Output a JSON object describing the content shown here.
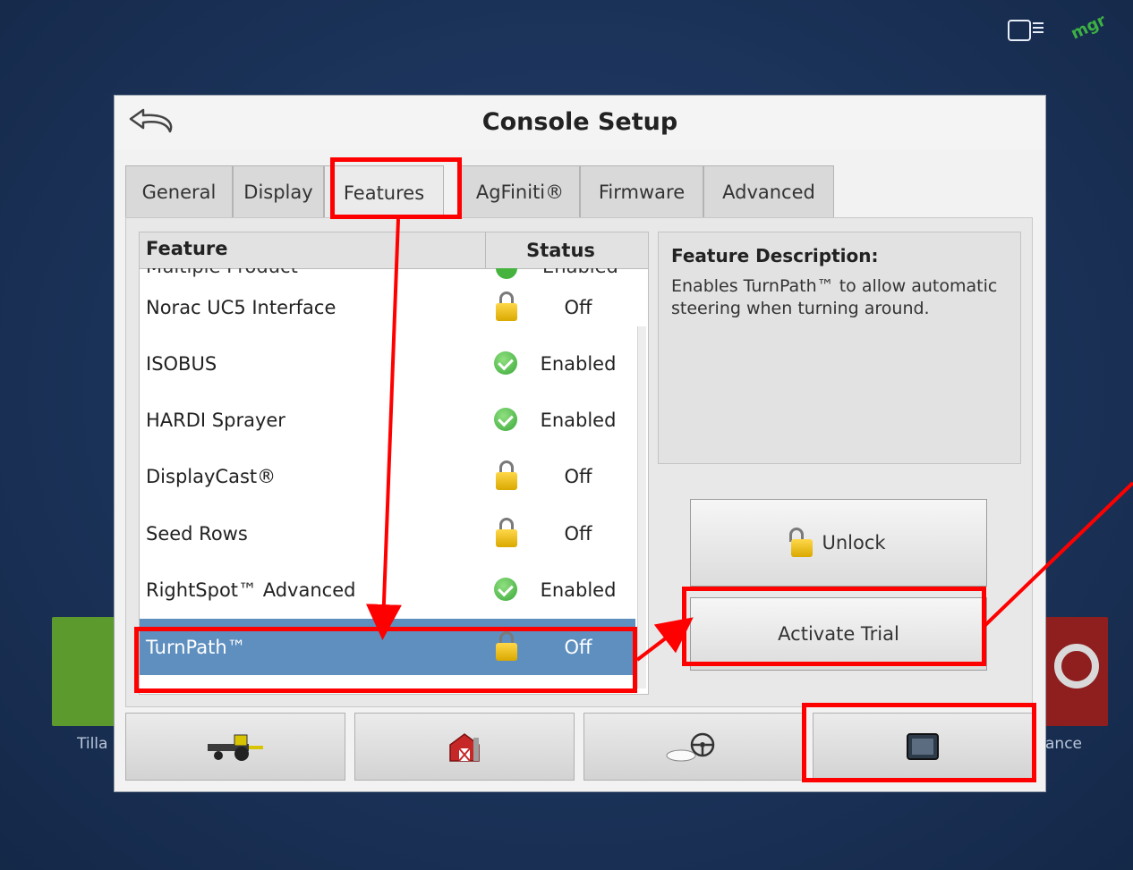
{
  "background": {
    "left_tile_label": "Tilla",
    "right_tile_label": "ance",
    "logo_text": "mgr"
  },
  "dialog": {
    "title": "Console Setup",
    "tabs": [
      "General",
      "Display",
      "Features",
      "AgFiniti®",
      "Firmware",
      "Advanced"
    ],
    "active_tab": "Features"
  },
  "feature_list": {
    "header_feature": "Feature",
    "header_status": "Status",
    "partial_row": {
      "name": "Multiple Product",
      "status": "Enabled"
    },
    "rows": [
      {
        "name": "Norac UC5 Interface",
        "status": "Off",
        "icon": "lock-icon"
      },
      {
        "name": "ISOBUS",
        "status": "Enabled",
        "icon": "check-icon"
      },
      {
        "name": "HARDI Sprayer",
        "status": "Enabled",
        "icon": "check-icon"
      },
      {
        "name": "DisplayCast®",
        "status": "Off",
        "icon": "lock-icon"
      },
      {
        "name": "Seed Rows",
        "status": "Off",
        "icon": "lock-icon"
      },
      {
        "name": "RightSpot™ Advanced",
        "status": "Enabled",
        "icon": "check-icon"
      },
      {
        "name": "TurnPath™",
        "status": "Off",
        "icon": "lock-icon",
        "selected": true
      }
    ]
  },
  "description": {
    "title": "Feature Description:",
    "text": "Enables TurnPath™ to allow automatic steering when turning around."
  },
  "buttons": {
    "unlock": "Unlock",
    "activate_trial": "Activate Trial"
  },
  "bottom_bar": [
    "tractor-icon",
    "barn-icon",
    "steering-icon",
    "display-icon"
  ],
  "colors": {
    "highlight": "#ff0000",
    "selected_row": "#5f8fbf",
    "background": "#1d355d"
  }
}
